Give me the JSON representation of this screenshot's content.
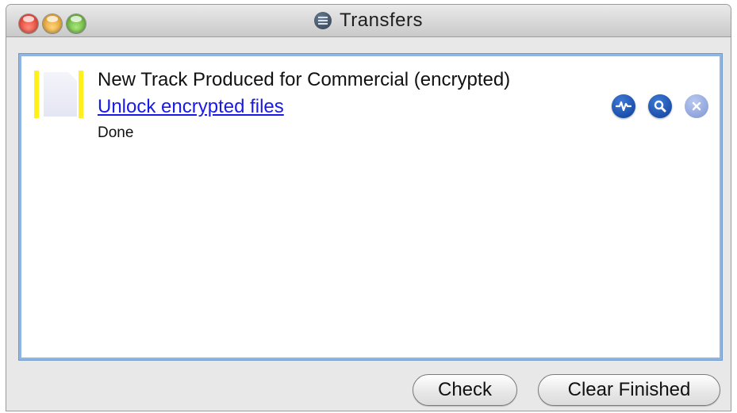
{
  "window": {
    "title": "Transfers"
  },
  "transfers": [
    {
      "title": "New Track Produced for Commercial (encrypted)",
      "link_label": "Unlock encrypted files",
      "status": "Done",
      "accent_color": "#ffef1a",
      "actions": [
        {
          "icon": "waveform-icon"
        },
        {
          "icon": "magnifier-icon"
        },
        {
          "icon": "remove-icon"
        }
      ]
    }
  ],
  "footer": {
    "check_label": "Check",
    "clear_label": "Clear Finished"
  },
  "colors": {
    "link": "#1a1ae6",
    "list_border": "#8fb6e3",
    "action_blue": "#0b3f99"
  }
}
